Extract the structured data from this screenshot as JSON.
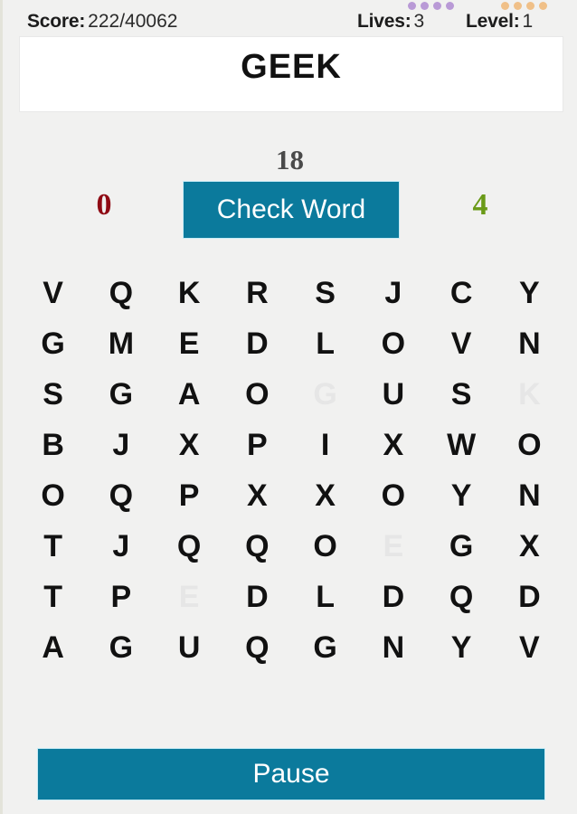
{
  "status": {
    "score_label": "Score:",
    "score_value": "222/40062",
    "lives_label": "Lives:",
    "lives_value": "3",
    "level_label": "Level:",
    "level_value": "1"
  },
  "indicators": {
    "purple_color": "#b99ad6",
    "purple_count": 4,
    "orange_color": "#f0c088",
    "orange_count": 4
  },
  "word_panel": {
    "word": "GEEK"
  },
  "counters": {
    "timer": "18",
    "wrong": "0",
    "wrong_color": "#8f0a14",
    "correct": "4",
    "correct_color": "#6a9a17"
  },
  "buttons": {
    "check_word": "Check Word",
    "pause": "Pause",
    "accent_color": "#0b7a9c"
  },
  "grid": {
    "rows": 8,
    "cols": 8,
    "used_color": "#e6e6e6",
    "letters": [
      [
        {
          "ch": "V",
          "used": false
        },
        {
          "ch": "Q",
          "used": false
        },
        {
          "ch": "K",
          "used": false
        },
        {
          "ch": "R",
          "used": false
        },
        {
          "ch": "S",
          "used": false
        },
        {
          "ch": "J",
          "used": false
        },
        {
          "ch": "C",
          "used": false
        },
        {
          "ch": "Y",
          "used": false
        }
      ],
      [
        {
          "ch": "G",
          "used": false
        },
        {
          "ch": "M",
          "used": false
        },
        {
          "ch": "E",
          "used": false
        },
        {
          "ch": "D",
          "used": false
        },
        {
          "ch": "L",
          "used": false
        },
        {
          "ch": "O",
          "used": false
        },
        {
          "ch": "V",
          "used": false
        },
        {
          "ch": "N",
          "used": false
        }
      ],
      [
        {
          "ch": "S",
          "used": false
        },
        {
          "ch": "G",
          "used": false
        },
        {
          "ch": "A",
          "used": false
        },
        {
          "ch": "O",
          "used": false
        },
        {
          "ch": "G",
          "used": true
        },
        {
          "ch": "U",
          "used": false
        },
        {
          "ch": "S",
          "used": false
        },
        {
          "ch": "K",
          "used": true
        }
      ],
      [
        {
          "ch": "B",
          "used": false
        },
        {
          "ch": "J",
          "used": false
        },
        {
          "ch": "X",
          "used": false
        },
        {
          "ch": "P",
          "used": false
        },
        {
          "ch": "I",
          "used": false
        },
        {
          "ch": "X",
          "used": false
        },
        {
          "ch": "W",
          "used": false
        },
        {
          "ch": "O",
          "used": false
        }
      ],
      [
        {
          "ch": "O",
          "used": false
        },
        {
          "ch": "Q",
          "used": false
        },
        {
          "ch": "P",
          "used": false
        },
        {
          "ch": "X",
          "used": false
        },
        {
          "ch": "X",
          "used": false
        },
        {
          "ch": "O",
          "used": false
        },
        {
          "ch": "Y",
          "used": false
        },
        {
          "ch": "N",
          "used": false
        }
      ],
      [
        {
          "ch": "T",
          "used": false
        },
        {
          "ch": "J",
          "used": false
        },
        {
          "ch": "Q",
          "used": false
        },
        {
          "ch": "Q",
          "used": false
        },
        {
          "ch": "O",
          "used": false
        },
        {
          "ch": "E",
          "used": true
        },
        {
          "ch": "G",
          "used": false
        },
        {
          "ch": "X",
          "used": false
        }
      ],
      [
        {
          "ch": "T",
          "used": false
        },
        {
          "ch": "P",
          "used": false
        },
        {
          "ch": "E",
          "used": true
        },
        {
          "ch": "D",
          "used": false
        },
        {
          "ch": "L",
          "used": false
        },
        {
          "ch": "D",
          "used": false
        },
        {
          "ch": "Q",
          "used": false
        },
        {
          "ch": "D",
          "used": false
        }
      ],
      [
        {
          "ch": "A",
          "used": false
        },
        {
          "ch": "G",
          "used": false
        },
        {
          "ch": "U",
          "used": false
        },
        {
          "ch": "Q",
          "used": false
        },
        {
          "ch": "G",
          "used": false
        },
        {
          "ch": "N",
          "used": false
        },
        {
          "ch": "Y",
          "used": false
        },
        {
          "ch": "V",
          "used": false
        }
      ]
    ]
  }
}
